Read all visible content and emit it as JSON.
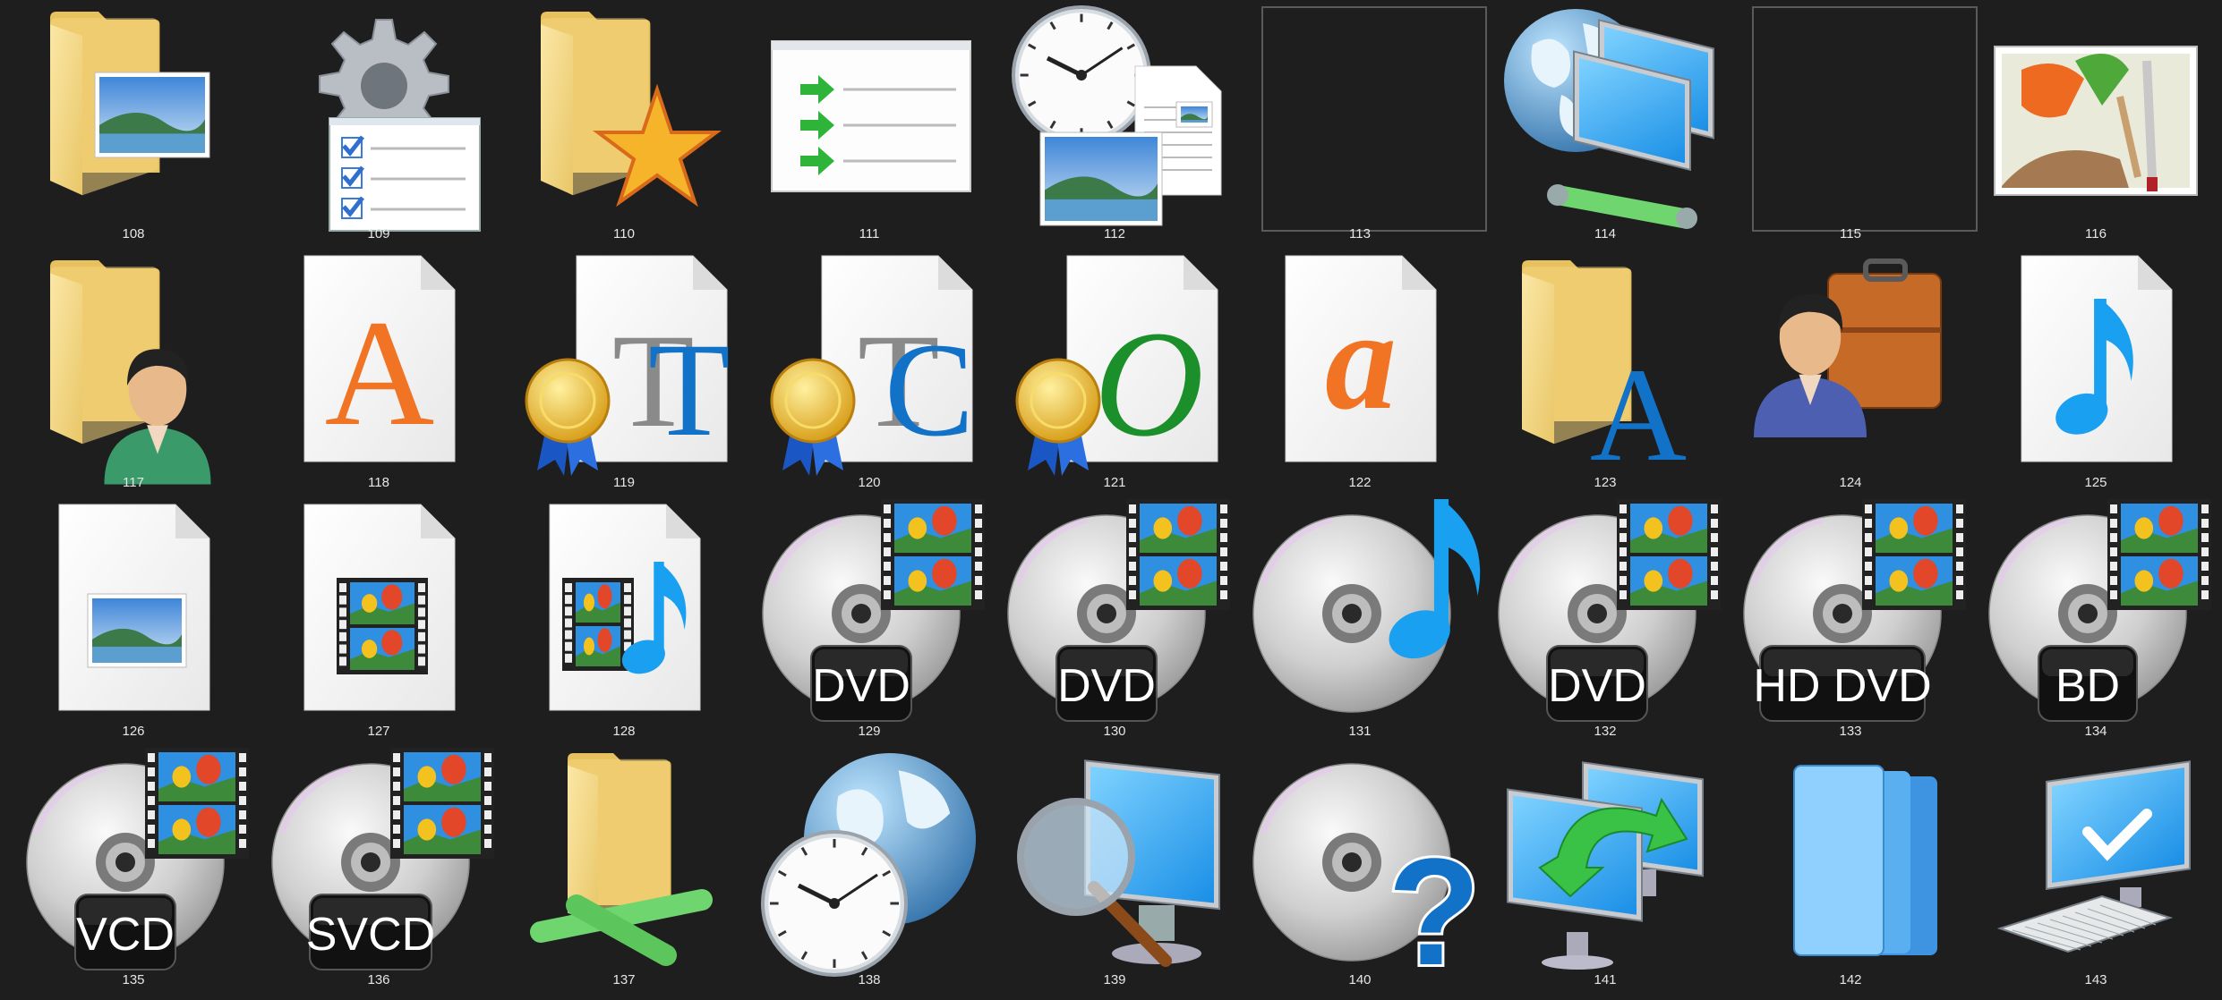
{
  "background": "#1e1e1e",
  "icons": [
    {
      "number": "108",
      "icon": "folder-pictures-icon"
    },
    {
      "number": "109",
      "icon": "gear-task-list-icon"
    },
    {
      "number": "110",
      "icon": "folder-favorites-icon"
    },
    {
      "number": "111",
      "icon": "green-arrow-list-icon"
    },
    {
      "number": "112",
      "icon": "clock-documents-picture-icon"
    },
    {
      "number": "113",
      "icon": "blank-frame-icon"
    },
    {
      "number": "114",
      "icon": "globe-network-computers-icon"
    },
    {
      "number": "115",
      "icon": "blank-frame-icon"
    },
    {
      "number": "116",
      "icon": "paint-palette-brushes-icon"
    },
    {
      "number": "117",
      "icon": "folder-user-icon"
    },
    {
      "number": "118",
      "icon": "font-file-icon",
      "glyph": "A"
    },
    {
      "number": "119",
      "icon": "truetype-font-certified-icon",
      "glyph": "TT"
    },
    {
      "number": "120",
      "icon": "truetype-collection-certified-icon",
      "glyph": "C"
    },
    {
      "number": "121",
      "icon": "opentype-font-certified-icon",
      "glyph": "O"
    },
    {
      "number": "122",
      "icon": "raster-font-file-icon",
      "glyph": "a"
    },
    {
      "number": "123",
      "icon": "folder-fonts-icon",
      "glyph": "A"
    },
    {
      "number": "124",
      "icon": "user-briefcase-icon"
    },
    {
      "number": "125",
      "icon": "music-file-icon"
    },
    {
      "number": "126",
      "icon": "picture-file-icon"
    },
    {
      "number": "127",
      "icon": "video-file-icon"
    },
    {
      "number": "128",
      "icon": "video-music-file-icon"
    },
    {
      "number": "129",
      "icon": "dvd-video-disc-icon",
      "badge": "DVD"
    },
    {
      "number": "130",
      "icon": "dvd-video-disc-icon",
      "badge": "DVD"
    },
    {
      "number": "131",
      "icon": "audio-disc-icon"
    },
    {
      "number": "132",
      "icon": "dvd-video-disc-icon",
      "badge": "DVD"
    },
    {
      "number": "133",
      "icon": "hd-dvd-disc-icon",
      "badge": "HD DVD"
    },
    {
      "number": "134",
      "icon": "bluray-disc-icon",
      "badge": "BD"
    },
    {
      "number": "135",
      "icon": "vcd-disc-icon",
      "badge": "VCD"
    },
    {
      "number": "136",
      "icon": "svcd-disc-icon",
      "badge": "SVCD"
    },
    {
      "number": "137",
      "icon": "folder-network-icon"
    },
    {
      "number": "138",
      "icon": "globe-clock-icon"
    },
    {
      "number": "139",
      "icon": "monitor-magnifier-icon"
    },
    {
      "number": "140",
      "icon": "unknown-disc-icon"
    },
    {
      "number": "141",
      "icon": "computers-sync-arrow-icon"
    },
    {
      "number": "142",
      "icon": "stacked-blue-folders-icon"
    },
    {
      "number": "143",
      "icon": "computer-checkmark-icon"
    }
  ]
}
